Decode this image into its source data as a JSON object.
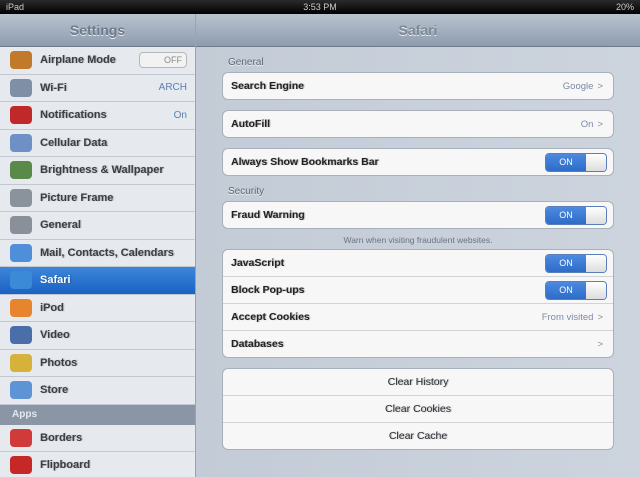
{
  "status_bar": {
    "left": "iPad",
    "time": "3:53 PM",
    "battery": "20%"
  },
  "sidebar": {
    "title": "Settings",
    "items": [
      {
        "label": "Airplane Mode",
        "icon": "airplane-icon",
        "color": "#c07a2a",
        "toggle": "OFF"
      },
      {
        "label": "Wi-Fi",
        "icon": "wifi-icon",
        "color": "#7e8fa6",
        "value": "ARCH"
      },
      {
        "label": "Notifications",
        "icon": "notifications-icon",
        "color": "#c0282a",
        "value": "On"
      },
      {
        "label": "Cellular Data",
        "icon": "cellular-icon",
        "color": "#6f8fc7"
      },
      {
        "label": "Brightness & Wallpaper",
        "icon": "brightness-icon",
        "color": "#5a8a4a"
      },
      {
        "label": "Picture Frame",
        "icon": "picture-frame-icon",
        "color": "#8a929c"
      },
      {
        "label": "General",
        "icon": "gear-icon",
        "color": "#8a9099"
      },
      {
        "label": "Mail, Contacts, Calendars",
        "icon": "mail-icon",
        "color": "#4f8fd9"
      },
      {
        "label": "Safari",
        "icon": "safari-icon",
        "color": "#3b8ad8"
      },
      {
        "label": "iPod",
        "icon": "ipod-icon",
        "color": "#e6852e"
      },
      {
        "label": "Video",
        "icon": "video-icon",
        "color": "#4a6fa8"
      },
      {
        "label": "Photos",
        "icon": "photos-icon",
        "color": "#d6b23a"
      },
      {
        "label": "Store",
        "icon": "store-icon",
        "color": "#5e93d6"
      }
    ],
    "apps_header": "Apps",
    "app_items": [
      {
        "label": "Borders",
        "icon": "borders-icon",
        "color": "#d03a3a"
      },
      {
        "label": "Flipboard",
        "icon": "flipboard-icon",
        "color": "#c62828"
      }
    ]
  },
  "detail": {
    "title": "Safari",
    "general_header": "General",
    "search_engine": {
      "label": "Search Engine",
      "value": "Google"
    },
    "autofill": {
      "label": "AutoFill",
      "value": "On"
    },
    "bookmarks_bar": {
      "label": "Always Show Bookmarks Bar",
      "toggle": "ON"
    },
    "security_header": "Security",
    "fraud_warning": {
      "label": "Fraud Warning",
      "toggle": "ON"
    },
    "fraud_note": "Warn when visiting fraudulent websites.",
    "javascript": {
      "label": "JavaScript",
      "toggle": "ON"
    },
    "block_popups": {
      "label": "Block Pop-ups",
      "toggle": "ON"
    },
    "accept_cookies": {
      "label": "Accept Cookies",
      "value": "From visited"
    },
    "databases": {
      "label": "Databases"
    },
    "clear_history": "Clear History",
    "clear_cookies": "Clear Cookies",
    "clear_cache": "Clear Cache",
    "chevron": ">"
  }
}
